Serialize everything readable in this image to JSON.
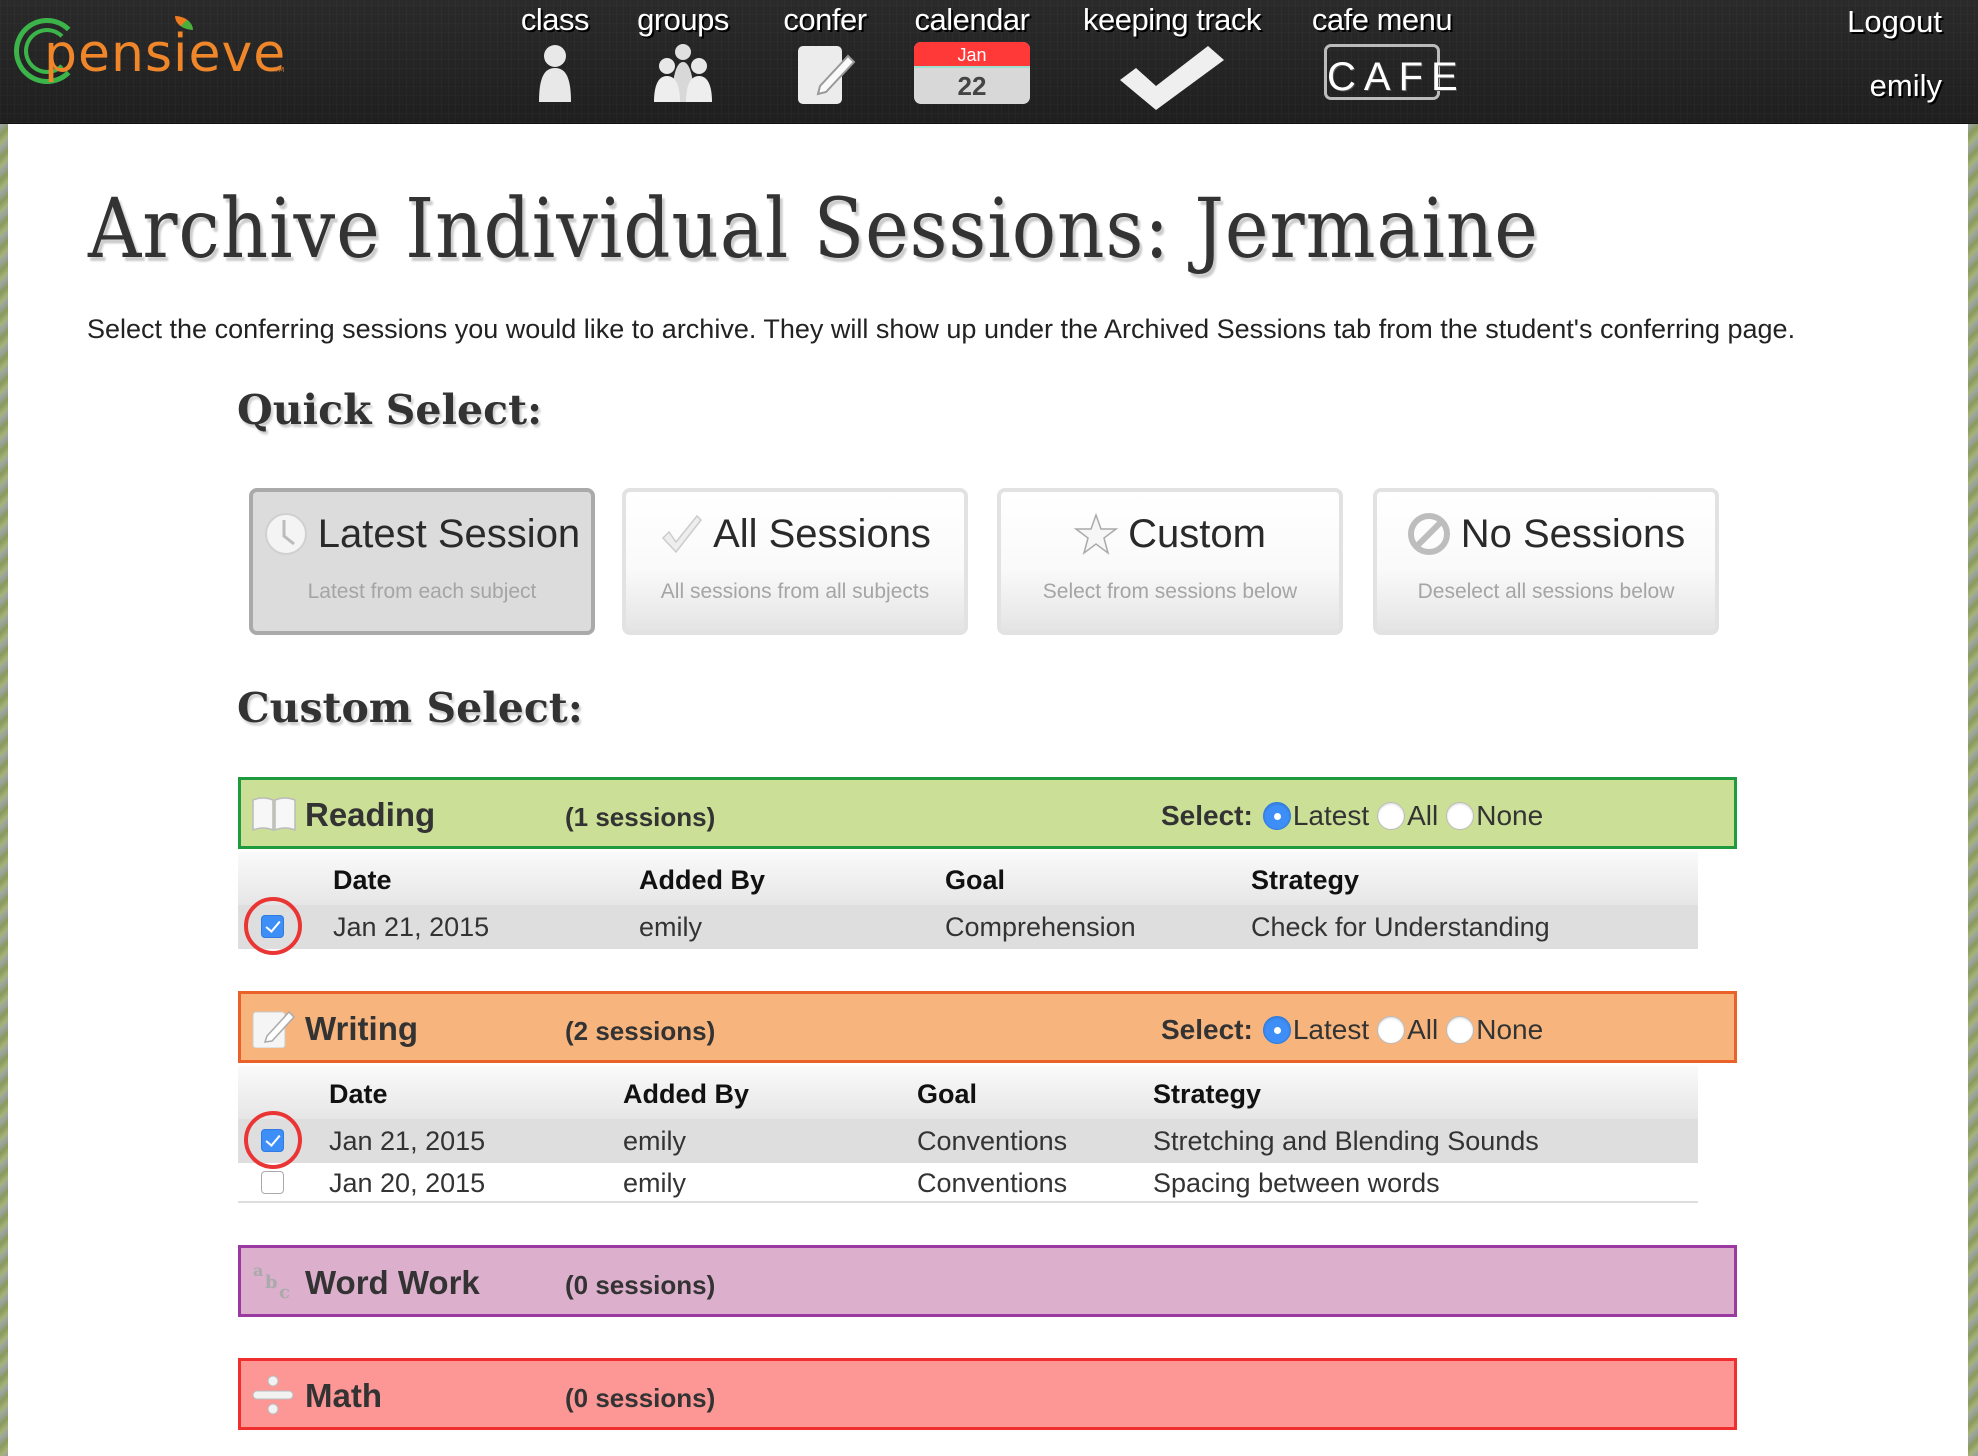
{
  "header": {
    "logo_text": "pensieve",
    "logo_tm": "TM",
    "nav": [
      {
        "label": "class",
        "icon": "person-icon"
      },
      {
        "label": "groups",
        "icon": "group-icon"
      },
      {
        "label": "confer",
        "icon": "notepad-pencil-icon"
      },
      {
        "label": "calendar",
        "icon": "calendar-icon",
        "month": "Jan",
        "day": "22"
      },
      {
        "label": "keeping track",
        "icon": "checkmark-icon"
      },
      {
        "label": "cafe menu",
        "icon": "cafe-sign-icon",
        "sign_text": "CAFE"
      }
    ],
    "logout_label": "Logout",
    "username": "emily"
  },
  "page": {
    "title": "Archive Individual Sessions: Jermaine",
    "subtitle": "Select the conferring sessions you would like to archive. They will show up under the Archived Sessions tab from the student's conferring page.",
    "quick_select_heading": "Quick Select:",
    "custom_select_heading": "Custom Select:"
  },
  "quick_select": [
    {
      "title": "Latest Session",
      "subtitle": "Latest from each subject",
      "icon": "clock-icon",
      "active": true
    },
    {
      "title": "All Sessions",
      "subtitle": "All sessions from all subjects",
      "icon": "checkmark-icon",
      "active": false
    },
    {
      "title": "Custom",
      "subtitle": "Select from sessions below",
      "icon": "star-icon",
      "active": false
    },
    {
      "title": "No Sessions",
      "subtitle": "Deselect all sessions below",
      "icon": "no-entry-icon",
      "active": false
    }
  ],
  "select_options": {
    "label": "Select:",
    "latest": "Latest",
    "all": "All",
    "none": "None"
  },
  "subjects": [
    {
      "name": "Reading",
      "count": "(1 sessions)",
      "icon": "book-icon",
      "bg": "#cbe096",
      "border": "#1f9a3f",
      "selected_option": "Latest",
      "columns": [
        "Date",
        "Added By",
        "Goal",
        "Strategy"
      ],
      "rows": [
        {
          "date": "Jan 21, 2015",
          "added_by": "emily",
          "goal": "Comprehension",
          "strategy": "Check for Understanding",
          "checked": true
        }
      ]
    },
    {
      "name": "Writing",
      "count": "(2 sessions)",
      "icon": "notepad-pencil-icon",
      "bg": "#f7b57d",
      "border": "#e8622a",
      "selected_option": "Latest",
      "columns": [
        "Date",
        "Added By",
        "Goal",
        "Strategy"
      ],
      "rows": [
        {
          "date": "Jan 21, 2015",
          "added_by": "emily",
          "goal": "Conventions",
          "strategy": "Stretching and Blending Sounds",
          "checked": true
        },
        {
          "date": "Jan 20, 2015",
          "added_by": "emily",
          "goal": "Conventions",
          "strategy": "Spacing between words",
          "checked": false
        }
      ]
    },
    {
      "name": "Word Work",
      "count": "(0 sessions)",
      "icon": "abc-letters-icon",
      "bg": "#dcafcc",
      "border": "#9a3aa0",
      "rows": []
    },
    {
      "name": "Math",
      "count": "(0 sessions)",
      "icon": "division-icon",
      "bg": "#fd9796",
      "border": "#f02e2e",
      "rows": []
    }
  ],
  "colors": {
    "header_bg": "#242424",
    "checkbox_checked": "#3e8ef7",
    "annotation_ring": "#ea3535"
  }
}
